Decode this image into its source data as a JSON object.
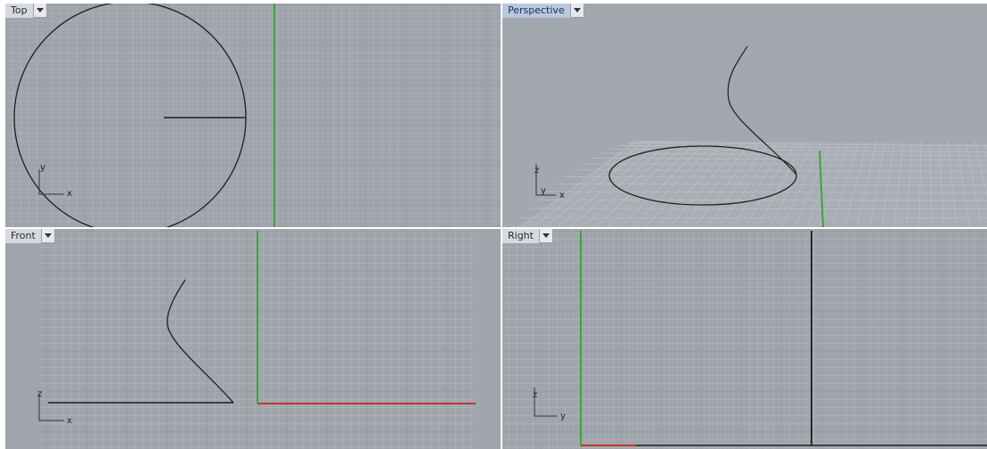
{
  "viewports": {
    "top": {
      "title": "Top",
      "axes": [
        "x",
        "y"
      ]
    },
    "perspective": {
      "title": "Perspective",
      "axes": [
        "x",
        "y",
        "z"
      ]
    },
    "front": {
      "title": "Front",
      "axes": [
        "x",
        "z"
      ]
    },
    "right": {
      "title": "Right",
      "axes": [
        "y",
        "z"
      ]
    }
  },
  "colors": {
    "viewport_bg": "#a0a5ac",
    "grid_minor": "#b3b8bf",
    "grid_major": "#8c9198",
    "axis_green": "#3da53a",
    "axis_red": "#c0392b",
    "curve": "#1e1e1e",
    "active_tab": "#b9c8df"
  },
  "icons": {
    "viewport_menu": "dropdown-arrow-icon"
  }
}
